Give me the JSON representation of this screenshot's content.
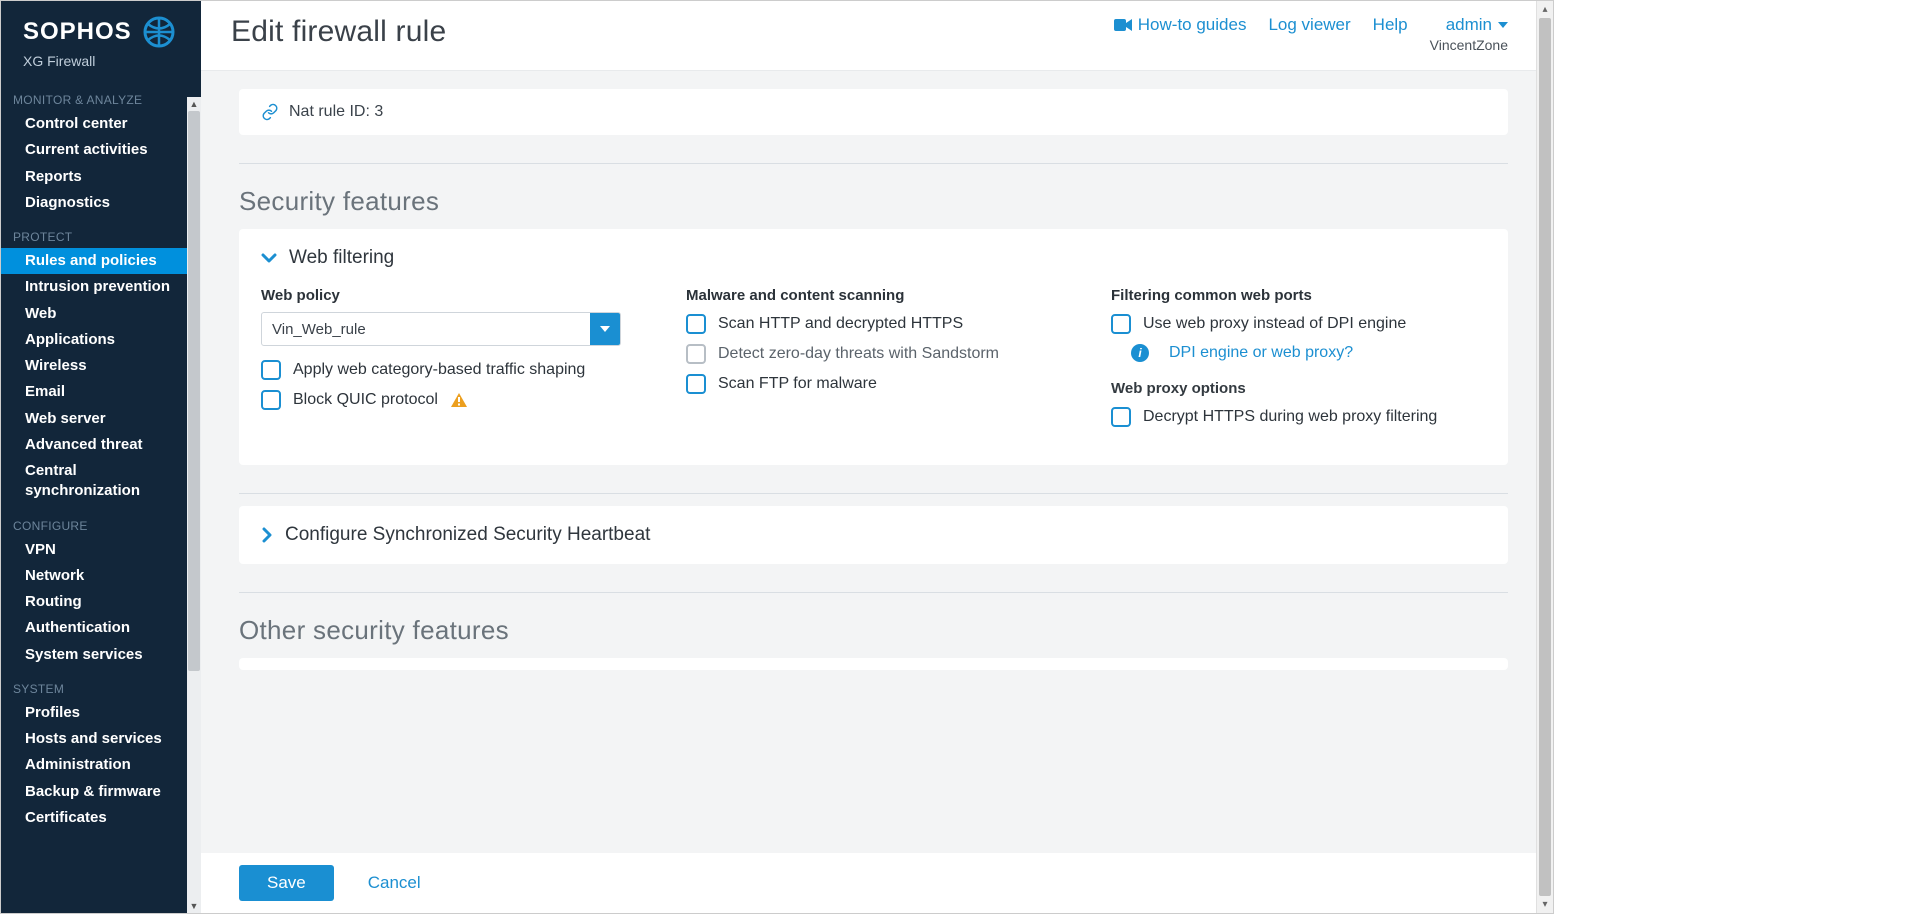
{
  "brand": {
    "name": "SOPHOS",
    "sub": "XG Firewall"
  },
  "sidebar": {
    "sections": [
      {
        "title": "MONITOR & ANALYZE",
        "items": [
          "Control center",
          "Current activities",
          "Reports",
          "Diagnostics"
        ]
      },
      {
        "title": "PROTECT",
        "items": [
          "Rules and policies",
          "Intrusion prevention",
          "Web",
          "Applications",
          "Wireless",
          "Email",
          "Web server",
          "Advanced threat",
          "Central synchronization"
        ],
        "activeIndex": 0
      },
      {
        "title": "CONFIGURE",
        "items": [
          "VPN",
          "Network",
          "Routing",
          "Authentication",
          "System services"
        ]
      },
      {
        "title": "SYSTEM",
        "items": [
          "Profiles",
          "Hosts and services",
          "Administration",
          "Backup & firmware",
          "Certificates"
        ]
      }
    ]
  },
  "topbar": {
    "title": "Edit firewall rule",
    "howto": "How-to guides",
    "logviewer": "Log viewer",
    "help": "Help",
    "admin": "admin",
    "zone": "VincentZone"
  },
  "nat": {
    "label": "Nat rule ID: 3"
  },
  "security": {
    "heading": "Security features",
    "webFiltering": {
      "title": "Web filtering",
      "policyLabel": "Web policy",
      "policyValue": "Vin_Web_rule",
      "applyShaping": "Apply web category-based traffic shaping",
      "blockQuic": "Block QUIC protocol",
      "malwareHeading": "Malware and content scanning",
      "scanHttp": "Scan HTTP and decrypted HTTPS",
      "detectZero": "Detect zero-day threats with Sandstorm",
      "scanFtp": "Scan FTP for malware",
      "filteringHeading": "Filtering common web ports",
      "useProxy": "Use web proxy instead of DPI engine",
      "dpiHelp": "DPI engine or web proxy?",
      "proxyOptionsHeading": "Web proxy options",
      "decryptHttps": "Decrypt HTTPS during web proxy filtering"
    },
    "syncHeartbeat": "Configure Synchronized Security Heartbeat"
  },
  "other": {
    "heading": "Other security features"
  },
  "footer": {
    "save": "Save",
    "cancel": "Cancel"
  }
}
